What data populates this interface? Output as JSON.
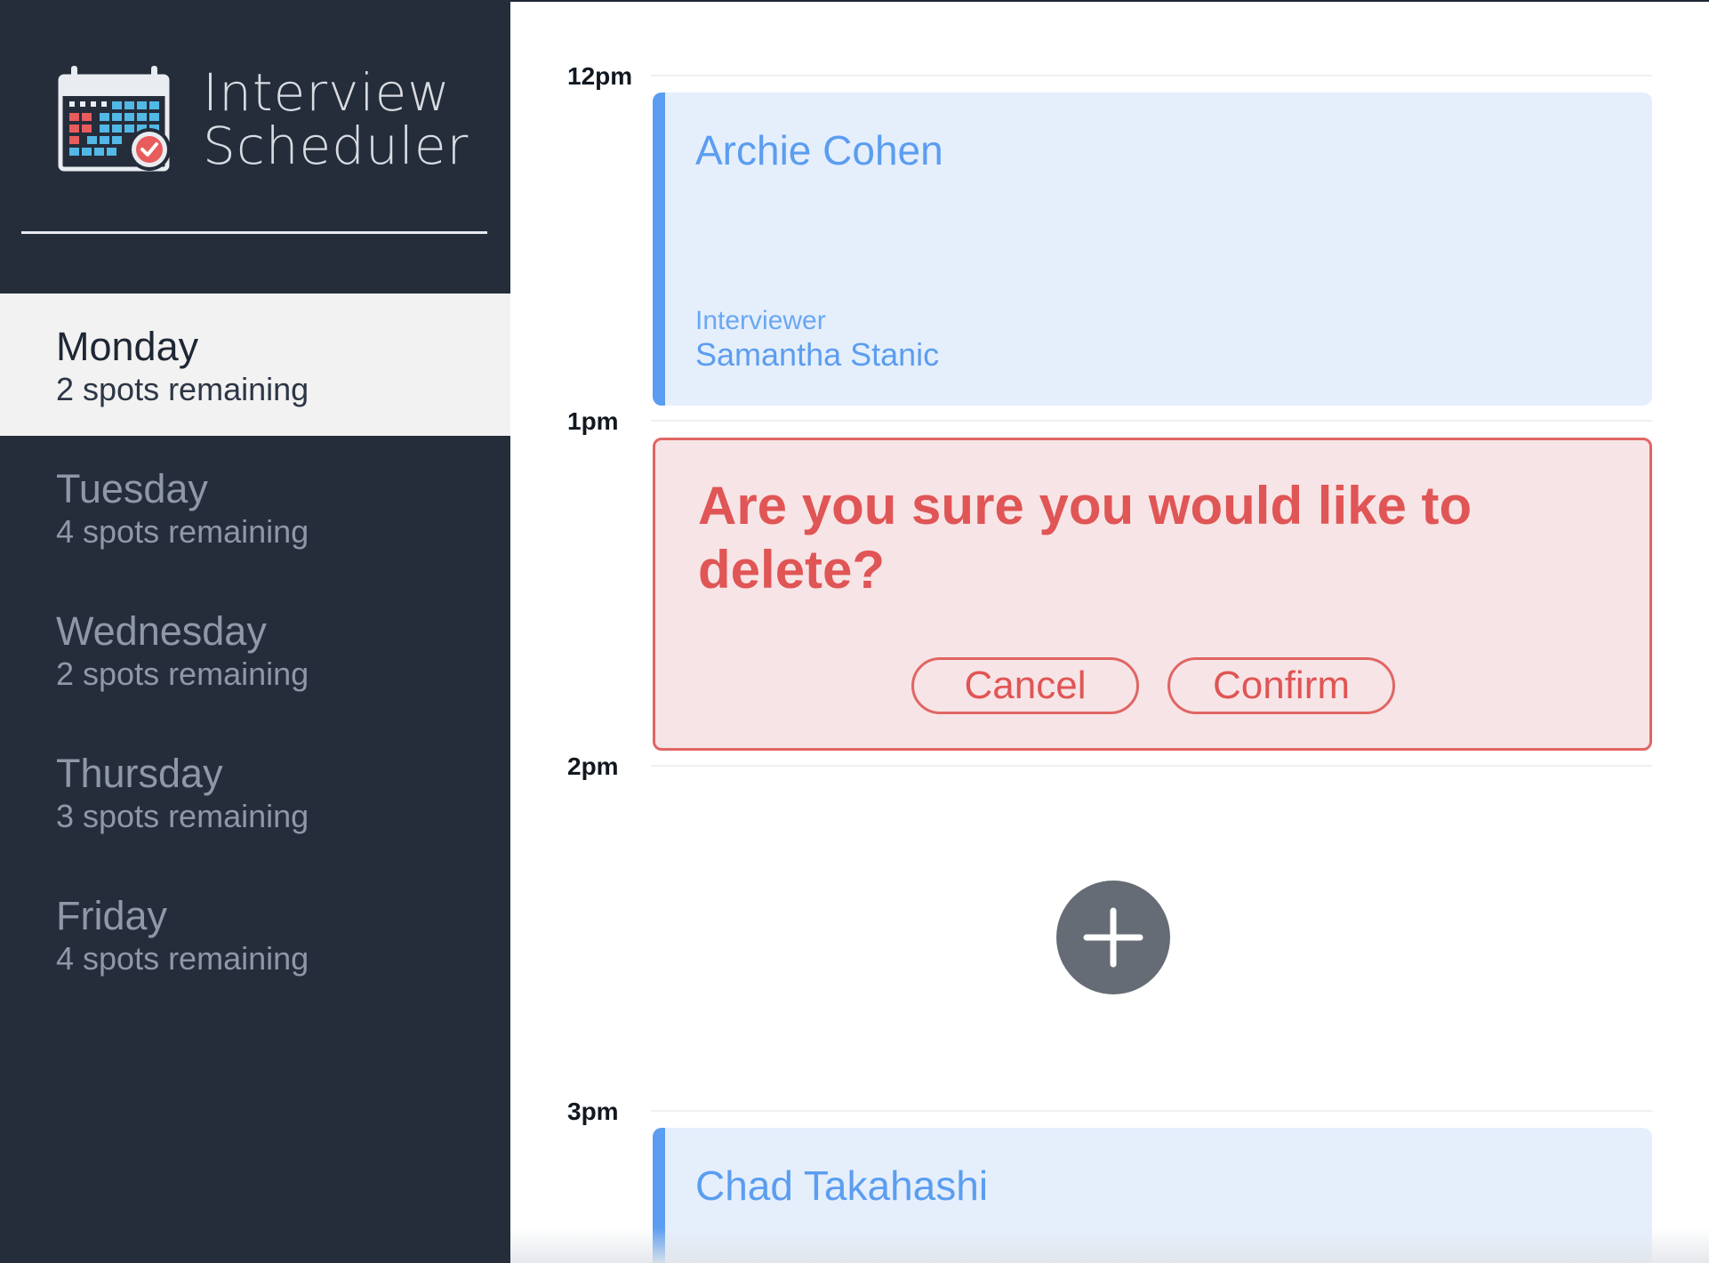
{
  "app": {
    "title_line1": "Interview",
    "title_line2": "Scheduler",
    "logo_icon": "calendar-check-icon"
  },
  "sidebar": {
    "days": [
      {
        "name": "Monday",
        "spots": "2 spots remaining",
        "selected": true
      },
      {
        "name": "Tuesday",
        "spots": "4 spots remaining",
        "selected": false
      },
      {
        "name": "Wednesday",
        "spots": "2 spots remaining",
        "selected": false
      },
      {
        "name": "Thursday",
        "spots": "3 spots remaining",
        "selected": false
      },
      {
        "name": "Friday",
        "spots": "4 spots remaining",
        "selected": false
      }
    ]
  },
  "schedule": {
    "hours": [
      "12pm",
      "1pm",
      "2pm",
      "3pm"
    ],
    "appointments": [
      {
        "student": "Archie Cohen",
        "interviewer_label": "Interviewer",
        "interviewer": "Samantha Stanic"
      },
      {
        "student": "Chad Takahashi"
      }
    ],
    "confirm": {
      "message": "Are you sure you would like to delete?",
      "cancel_label": "Cancel",
      "confirm_label": "Confirm"
    },
    "add_icon": "plus-icon"
  },
  "colors": {
    "sidebar_bg": "#252d3b",
    "selected_bg": "#f2f2f2",
    "accent_blue": "#5b9df0",
    "appointment_bg": "#e5effc",
    "danger_red": "#e05555",
    "danger_bg": "#f7e4e6",
    "add_button_bg": "#656c75"
  }
}
